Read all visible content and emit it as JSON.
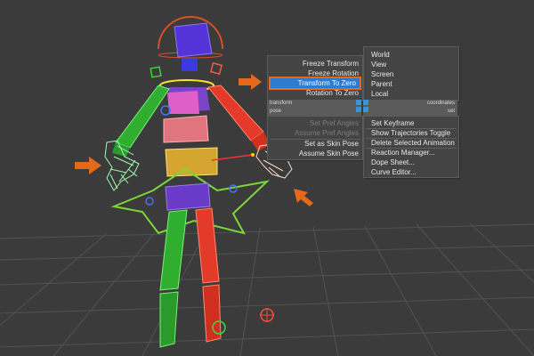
{
  "quad_menu": {
    "top_left": [
      {
        "label": "Freeze Transform",
        "state": "normal"
      },
      {
        "label": "Freeze Rotation",
        "state": "normal"
      },
      {
        "label": "Transform To Zero",
        "state": "selected"
      },
      {
        "label": "Rotation To Zero",
        "state": "normal"
      }
    ],
    "top_right": [
      {
        "label": "World"
      },
      {
        "label": "View"
      },
      {
        "label": "Screen"
      },
      {
        "label": "Parent"
      },
      {
        "label": "Local"
      }
    ],
    "bar_top_left": "transform",
    "bar_top_right": "coordinates",
    "bar_bottom_left": "pose",
    "bar_bottom_right": "set",
    "bottom_left": [
      {
        "label": "Set Pref Angles",
        "state": "disabled"
      },
      {
        "label": "Assume Pref Angles",
        "state": "disabled"
      },
      {
        "label": "Set as Skin Pose",
        "state": "normal"
      },
      {
        "label": "Assume Skin Pose",
        "state": "normal"
      }
    ],
    "bottom_right": [
      {
        "label": "Set Keyframe"
      },
      {
        "label": "Show Trajectories Toggle"
      },
      {
        "label": "Delete Selected Animation"
      },
      {
        "label": "Reaction Manager..."
      },
      {
        "label": "Dope Sheet..."
      },
      {
        "label": "Curve Editor..."
      }
    ]
  },
  "colors": {
    "viewport_bg": "#3b3b3b",
    "grid": "#525252",
    "menu_bg": "#444444",
    "selected": "#2e7bd2",
    "callout": "#e36a1c",
    "biped_left": "#2fae2f",
    "biped_right": "#e33a2a",
    "spine": "#e05ec8",
    "pelvis": "#6a3ac8",
    "head": "#5533d8"
  },
  "icons": {
    "callout_arrow": "arrow-right-icon",
    "ik_control": "wireframe-hand-icon",
    "ground_marker": "sphere-gizmo-icon"
  }
}
